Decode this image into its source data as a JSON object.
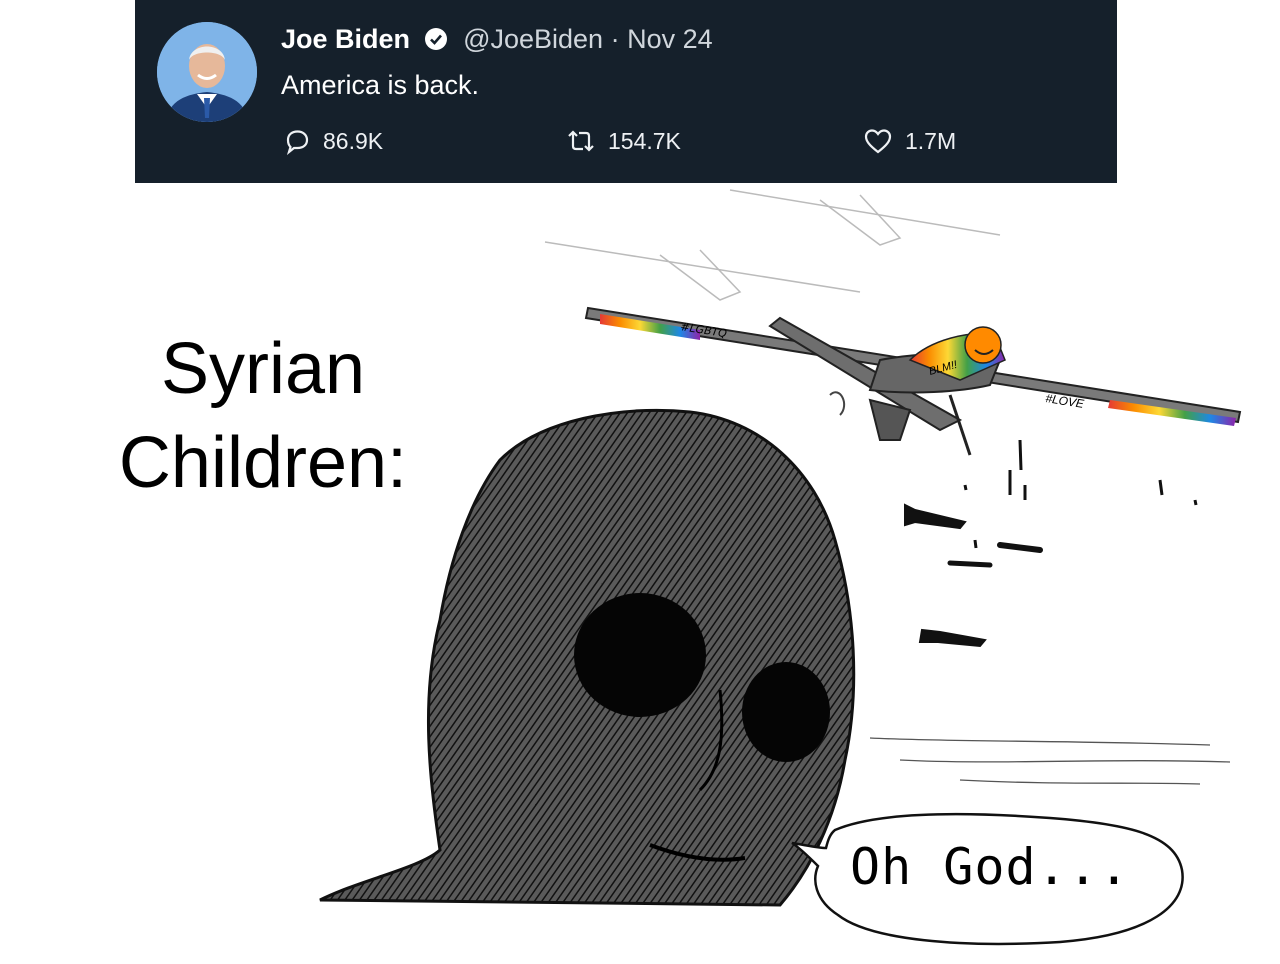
{
  "tweet": {
    "author_name": "Joe Biden",
    "handle": "@JoeBiden",
    "separator": "·",
    "date": "Nov 24",
    "text": "America is back.",
    "replies": "86.9K",
    "retweets": "154.7K",
    "likes": "1.7M",
    "icons": [
      "verified-icon",
      "reply-icon",
      "retweet-icon",
      "like-icon"
    ],
    "colors": {
      "background": "#15202b",
      "text": "#ffffff",
      "verified": "#ffffff"
    }
  },
  "meme": {
    "caption_line1": "Syrian",
    "caption_line2": "Children:",
    "speech_bubble": "Oh God...",
    "drone_tags": [
      "#LGBTQ",
      "BLM!!",
      "#LOVE"
    ]
  }
}
